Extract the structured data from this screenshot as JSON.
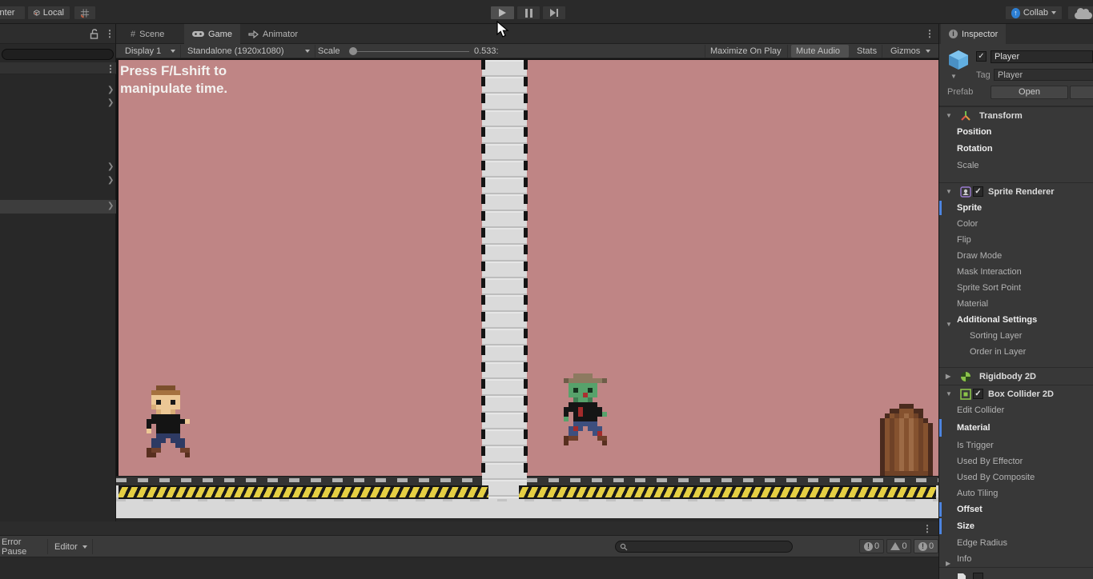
{
  "colors": {
    "accent_blue": "#4c84e0",
    "game_background": "#bf8585",
    "hazard_yellow": "#e5cf43",
    "selection_play_tint": "#4f4f4f"
  },
  "topbar": {
    "pivot_button": "nter",
    "local_button": "Local",
    "collab_button": "Collab"
  },
  "view_tabs": {
    "scene": "Scene",
    "game": "Game",
    "animator": "Animator"
  },
  "game_toolbar": {
    "display": "Display 1",
    "resolution": "Standalone (1920x1080)",
    "scale_label": "Scale",
    "scale_value": "0.533:",
    "maximize_on_play": "Maximize On Play",
    "mute_audio": "Mute Audio",
    "stats": "Stats",
    "gizmos": "Gizmos"
  },
  "game": {
    "hint_line1": "Press F/Lshift to",
    "hint_line2": "manipulate time."
  },
  "inspector": {
    "tab": "Inspector",
    "object_name": "Player",
    "tag_label": "Tag",
    "tag_value": "Player",
    "prefab_label": "Prefab",
    "open_button": "Open",
    "transform": {
      "title": "Transform",
      "rows": [
        "Position",
        "Rotation",
        "Scale"
      ]
    },
    "sprite_renderer": {
      "title": "Sprite Renderer",
      "rows": [
        "Sprite",
        "Color",
        "Flip",
        "Draw Mode",
        "Mask Interaction",
        "Sprite Sort Point",
        "Material",
        "Additional Settings",
        "Sorting Layer",
        "Order in Layer"
      ]
    },
    "rigidbody": {
      "title": "Rigidbody 2D"
    },
    "box_collider": {
      "title": "Box Collider 2D",
      "rows": [
        "Edit Collider",
        "Material",
        "Is Trigger",
        "Used By Effector",
        "Used By Composite",
        "Auto Tiling",
        "Offset",
        "Size",
        "Edge Radius",
        "Info"
      ]
    }
  },
  "console": {
    "error_pause": "Error Pause",
    "editor": "Editor",
    "info_count": "0",
    "warning_count": "0",
    "error_count": "0"
  },
  "sprites": {
    "player": {
      "px": 6,
      "palette": {
        "C": "#7c4f2c",
        "B": "#a5713f",
        "S": "#ecc795",
        "s": "#d8ad77",
        "E": "#191919",
        "K": "#141414",
        "P": "#2e3a63",
        "H": "#6f3f2b",
        "h": "#582f1f"
      },
      "rows": [
        "..CCCC....",
        ".BBBBBB...",
        ".SSSSSS...",
        ".SESSES...",
        ".sSSSSS...",
        "..sSSs....",
        ".KKKKKK...",
        "KKKKKKKKS.",
        "K.KKKKK...",
        "S.KKKKK...",
        "..PPPPP...",
        ".PPP.PPP..",
        ".PP...PP..",
        "hHH....HH.",
        "hh......h."
      ]
    },
    "zombie": {
      "px": 6,
      "palette": {
        "T": "#8d7a60",
        "t": "#6e5d48",
        "G": "#57a26b",
        "g": "#3f7e52",
        "E": "#16321f",
        "M": "#a93030",
        "K": "#151515",
        "R": "#a32b2b",
        "P": "#3d4f7e",
        "H": "#6f3f2b",
        "h": "#582f1f"
      },
      "rows": [
        "...TTTT....",
        ".tTTTTTTTt.",
        "..GGGGGG...",
        "..GEGGEG...",
        "..GGGMGG...",
        "...gGGg....",
        "..KKKKKK...",
        ".KKKRKKKK..",
        ".K.KRKKKKG.",
        ".G.KKKKK...",
        "...PPPPP...",
        "..PRP.PPP..",
        "..PP...PR..",
        ".hHH....HH.",
        ".h.......h."
      ]
    },
    "door": {
      "px": 6,
      "palette": {
        "D": "#4a2b1e",
        "M": "#85522f",
        "m": "#6f4227",
        "L": "#9c6a45"
      },
      "rows": [
        ".....DDD.....",
        "...DDMMMDD...",
        "..DMmMLMmD...",
        ".DMmMLMLMmD..",
        ".DMmMLMLMmMD.",
        ".DMmMLMLMmMD.",
        ".DMmMLMLMmMD.",
        ".DMmMLMLMmMD.",
        ".DMmMLMLMmMD.",
        ".DMmMLMLMmMD.",
        ".DMmMLMLMmMD.",
        ".DMmMLMLMmMD.",
        ".DMmMLMLMmMD.",
        ".DMmMLMLMmMD.",
        ".DmmmmmmmmmD."
      ]
    }
  }
}
